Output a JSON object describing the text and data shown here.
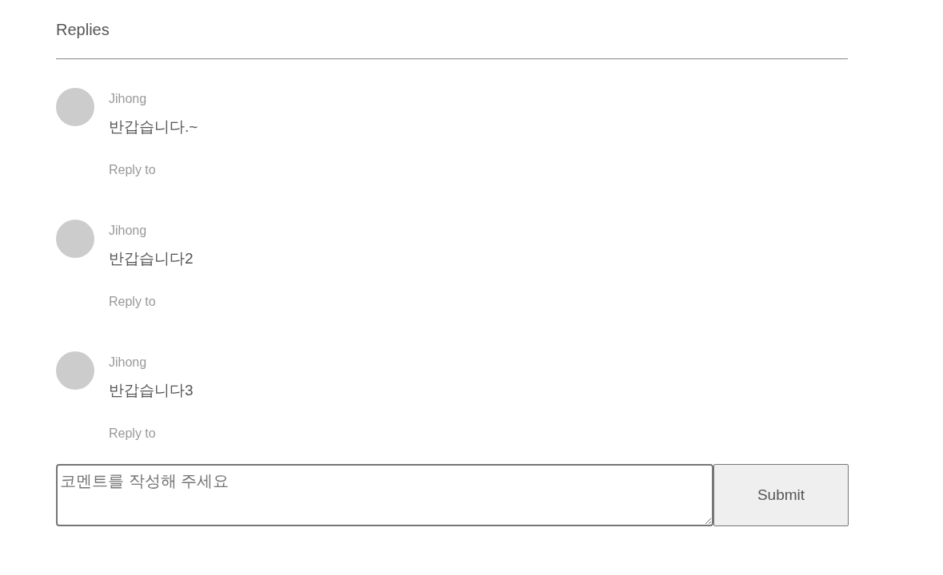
{
  "header": {
    "title": "Replies"
  },
  "comments": [
    {
      "author": "Jihong",
      "text": "반갑습니다.~",
      "reply_link": "Reply to"
    },
    {
      "author": "Jihong",
      "text": "반갑습니다2",
      "reply_link": "Reply to"
    },
    {
      "author": "Jihong",
      "text": "반갑습니다3",
      "reply_link": "Reply to"
    }
  ],
  "form": {
    "placeholder": "코멘트를 작성해 주세요",
    "submit_button": "Submit"
  }
}
